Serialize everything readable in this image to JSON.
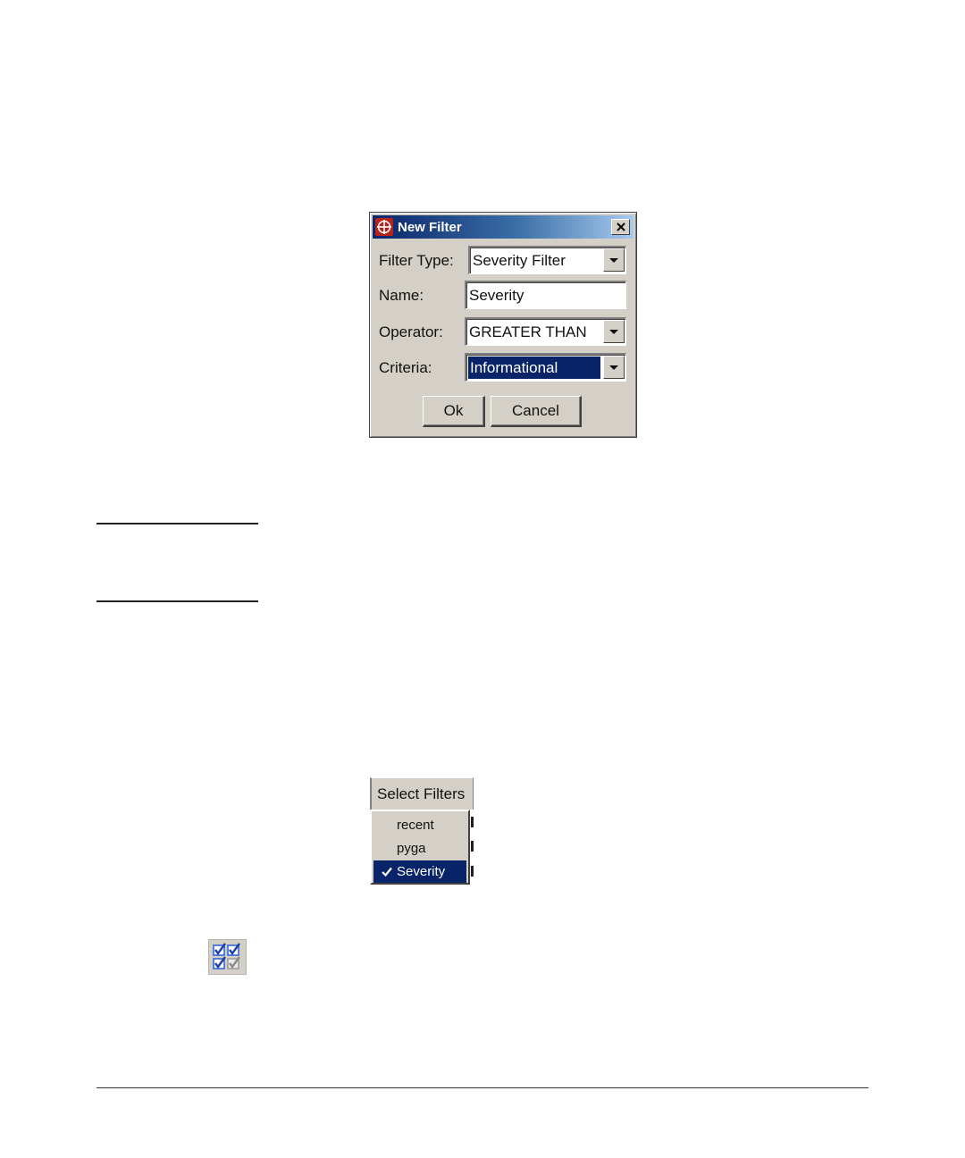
{
  "dialog": {
    "title": "New Filter",
    "filter_type_label": "Filter Type:",
    "filter_type_value": "Severity Filter",
    "name_label": "Name:",
    "name_value": "Severity",
    "operator_label": "Operator:",
    "operator_value": "GREATER THAN",
    "criteria_label": "Criteria:",
    "criteria_value": "Informational",
    "ok_label": "Ok",
    "cancel_label": "Cancel"
  },
  "select_filters": {
    "header": "Select Filters",
    "items": [
      {
        "label": "recent",
        "checked": false
      },
      {
        "label": "pyga",
        "checked": false
      },
      {
        "label": "Severity",
        "checked": true
      }
    ]
  },
  "icons": {
    "dialog_app": "app-crosshair-icon",
    "close": "close-icon",
    "dropdown": "chevron-down-icon",
    "menu_check": "checkmark-icon",
    "toolbar": "select-filters-checkboxes-icon"
  },
  "colors": {
    "window_face": "#d4d0c8",
    "title_gradient_start": "#0a246a",
    "title_gradient_end": "#a6caf0",
    "selection": "#0a246a",
    "app_icon": "#b8221b",
    "checkbox_blue": "#2a5fd6"
  }
}
